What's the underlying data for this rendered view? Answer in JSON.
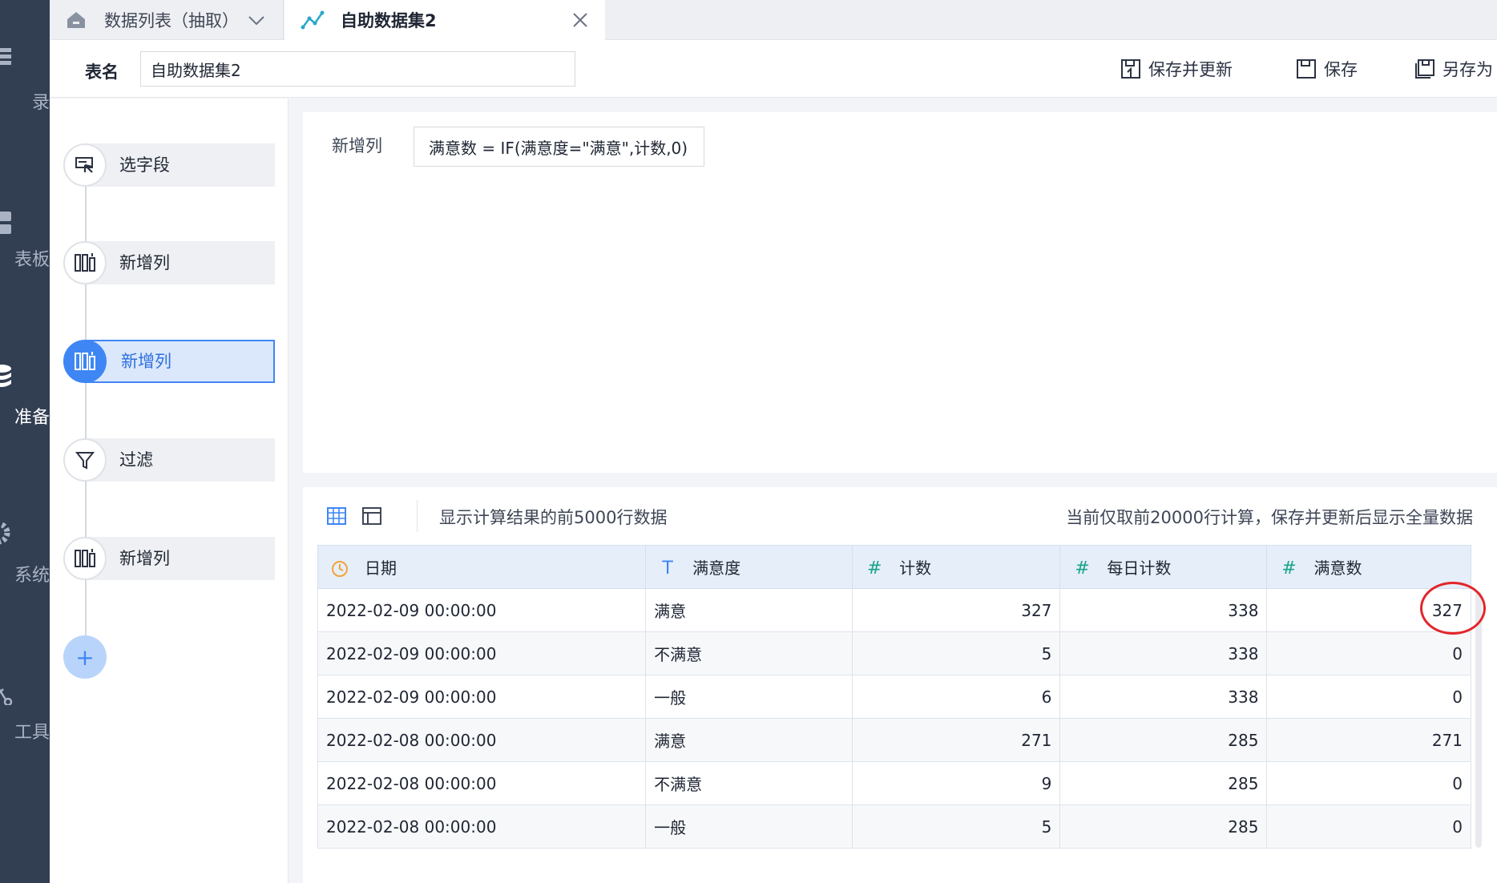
{
  "nav": {
    "items": [
      {
        "label": "录"
      },
      {
        "label": "表板"
      },
      {
        "label": "准备"
      },
      {
        "label": "系统"
      },
      {
        "label": "工具"
      }
    ]
  },
  "tabs": [
    {
      "label": "数据列表（抽取）"
    },
    {
      "label": "自助数据集2"
    }
  ],
  "header": {
    "table_name_label": "表名",
    "table_name_value": "自助数据集2",
    "save_update_label": "保存并更新",
    "save_label": "保存",
    "save_as_label": "另存为"
  },
  "steps": [
    {
      "label": "选字段"
    },
    {
      "label": "新增列"
    },
    {
      "label": "新增列"
    },
    {
      "label": "过滤"
    },
    {
      "label": "新增列"
    }
  ],
  "formula": {
    "label": "新增列",
    "expression": "满意数 = IF(满意度=\"满意\",计数,0)"
  },
  "preview": {
    "left_note": "显示计算结果的前5000行数据",
    "right_note": "当前仅取前20000行计算，保存并更新后显示全量数据",
    "columns": [
      {
        "type_icon": "clock-icon",
        "label": "日期"
      },
      {
        "type_icon": "text-type-icon",
        "label": "满意度"
      },
      {
        "type_icon": "number-type-icon",
        "label": "计数"
      },
      {
        "type_icon": "number-type-icon",
        "label": "每日计数"
      },
      {
        "type_icon": "number-type-icon",
        "label": "满意数"
      }
    ],
    "rows": [
      [
        "2022-02-09 00:00:00",
        "满意",
        "327",
        "338",
        "327"
      ],
      [
        "2022-02-09 00:00:00",
        "不满意",
        "5",
        "338",
        "0"
      ],
      [
        "2022-02-09 00:00:00",
        "一般",
        "6",
        "338",
        "0"
      ],
      [
        "2022-02-08 00:00:00",
        "满意",
        "271",
        "285",
        "271"
      ],
      [
        "2022-02-08 00:00:00",
        "不满意",
        "9",
        "285",
        "0"
      ],
      [
        "2022-02-08 00:00:00",
        "一般",
        "5",
        "285",
        "0"
      ]
    ]
  },
  "colors": {
    "accent": "#3f86f5",
    "nav_bg": "#323e52",
    "highlight_circle": "#e3262b"
  }
}
